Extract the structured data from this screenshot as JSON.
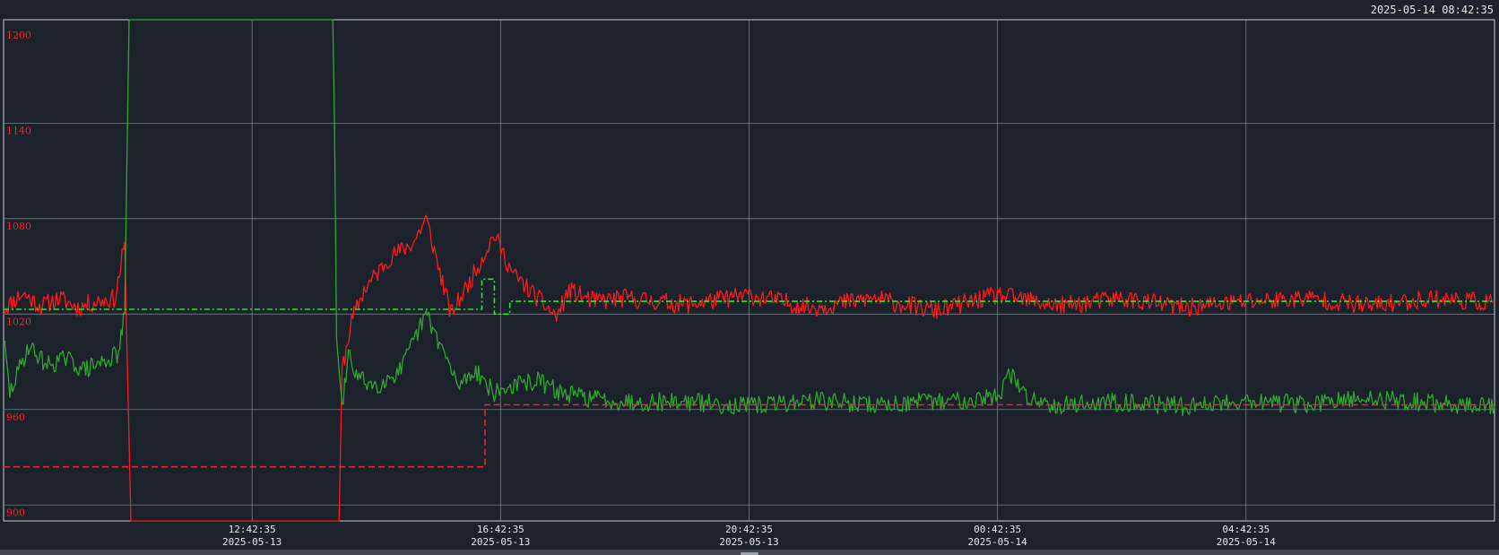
{
  "header": {
    "timestamp": "2025-05-14 08:42:35"
  },
  "chart_data": {
    "type": "line",
    "y_ticks": [
      "1200",
      "1140",
      "1080",
      "1020",
      "960",
      "900"
    ],
    "ylim": [
      890,
      1205
    ],
    "x_ticks": [
      {
        "time": "12:42:35",
        "date": "2025-05-13"
      },
      {
        "time": "16:42:35",
        "date": "2025-05-13"
      },
      {
        "time": "20:42:35",
        "date": "2025-05-13"
      },
      {
        "time": "00:42:35",
        "date": "2025-05-14"
      },
      {
        "time": "04:42:35",
        "date": "2025-05-14"
      }
    ],
    "xlim_hours": [
      -4.0,
      20.0
    ],
    "grid": true,
    "colors": {
      "red": "#ff1a1a",
      "green": "#2fa82f",
      "green_setpoint": "#22ee22",
      "red_setpoint": "#e62b2b",
      "grid": "#8a9098",
      "axis_text": "#ff2020",
      "time_text": "#e6e6e6"
    },
    "series": [
      {
        "style": "solid",
        "color_key": "red",
        "x": [
          -4.0,
          -3.7,
          -3.4,
          -3.1,
          -2.8,
          -2.5,
          -2.2,
          -2.05,
          -2.02,
          -1.95,
          1.4,
          1.45,
          1.6,
          1.8,
          2.2,
          2.6,
          2.8,
          3.0,
          3.2,
          3.5,
          3.9,
          4.2,
          4.6,
          4.9,
          5.1,
          5.5,
          6.0,
          7.0,
          8.0,
          9.0,
          10.0,
          11.0,
          12.0,
          13.0,
          14.0,
          15.0,
          16.0,
          17.0,
          18.0,
          19.0,
          20.0
        ],
        "y": [
          1023,
          1033,
          1025,
          1030,
          1024,
          1028,
          1030,
          1065,
          1010,
          890,
          890,
          985,
          1015,
          1035,
          1055,
          1065,
          1080,
          1050,
          1020,
          1040,
          1070,
          1045,
          1030,
          1018,
          1035,
          1028,
          1030,
          1026,
          1032,
          1024,
          1030,
          1022,
          1032,
          1025,
          1030,
          1024,
          1028,
          1030,
          1025,
          1030,
          1027
        ]
      },
      {
        "style": "solid",
        "color_key": "green",
        "x": [
          -4.0,
          -3.9,
          -3.6,
          -3.3,
          -3.0,
          -2.7,
          -2.4,
          -2.15,
          -2.05,
          -1.98,
          1.3,
          1.33,
          1.36,
          1.45,
          1.55,
          1.7,
          2.0,
          2.4,
          2.8,
          3.1,
          3.3,
          3.6,
          3.9,
          4.2,
          4.6,
          5.0,
          5.5,
          6.0,
          7.0,
          8.0,
          9.0,
          10.0,
          11.0,
          12.0,
          12.2,
          12.5,
          13.0,
          14.0,
          15.0,
          16.0,
          17.0,
          18.0,
          19.0,
          20.0
        ],
        "y": [
          1005,
          970,
          1000,
          988,
          992,
          985,
          990,
          995,
          1020,
          1205,
          1205,
          1130,
          1005,
          960,
          995,
          980,
          975,
          985,
          1020,
          995,
          975,
          985,
          970,
          975,
          978,
          970,
          967,
          965,
          965,
          962,
          966,
          963,
          965,
          968,
          982,
          967,
          963,
          965,
          962,
          966,
          963,
          967,
          964,
          962
        ]
      },
      {
        "style": "dash-dot",
        "color_key": "green_setpoint",
        "x": [
          -4.0,
          3.7,
          3.7,
          3.9,
          3.9,
          4.15,
          4.15,
          20.0
        ],
        "y": [
          1023,
          1023,
          1042,
          1042,
          1020,
          1020,
          1028,
          1028
        ]
      },
      {
        "style": "dashed",
        "color_key": "red_setpoint",
        "x": [
          -4.0,
          3.75,
          3.75,
          20.0
        ],
        "y": [
          924,
          924,
          963,
          963
        ]
      }
    ]
  }
}
